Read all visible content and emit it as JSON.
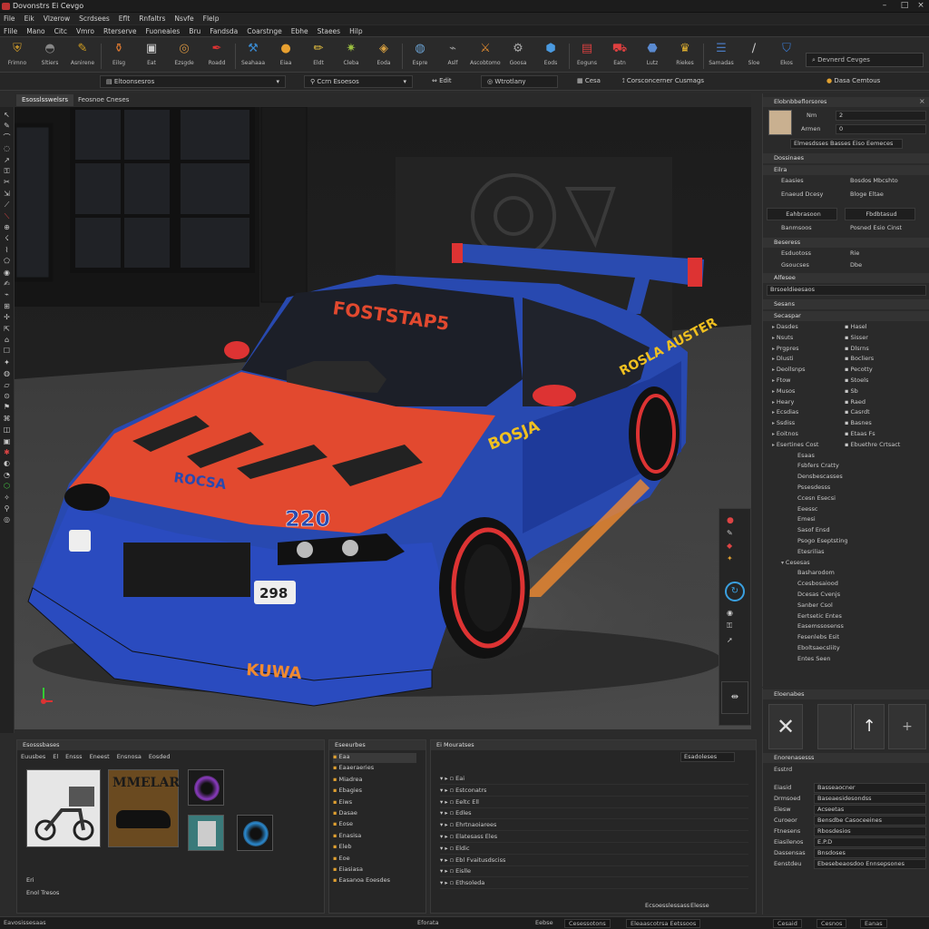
{
  "window": {
    "title": "Dovonstrs Ei Cevgo"
  },
  "menubar1": [
    "File",
    "Eik",
    "Vlzerow",
    "Scrdsees",
    "Eflt",
    "Rnfaltrs",
    "Nsvfe",
    "Flelp"
  ],
  "menubar2": [
    "Flile",
    "Mano",
    "Citc",
    "Vmro",
    "Rterserve",
    "Fuoneaies",
    "Bru",
    "Fandsda",
    "Coarstnge",
    "Ebhe",
    "Staees",
    "Hilp"
  ],
  "toolbar": {
    "buttons": [
      {
        "label": "Frimno",
        "icon": "shield-icon",
        "color": "#c8962a"
      },
      {
        "label": "Sltiers",
        "icon": "helmet-icon",
        "color": "#888"
      },
      {
        "label": "Asnirene",
        "icon": "brush-icon",
        "color": "#d4a020"
      },
      {
        "label": "Eilsg",
        "icon": "pot-icon",
        "color": "#e07a30"
      },
      {
        "label": "Eat",
        "icon": "box-icon",
        "color": "#ccc"
      },
      {
        "label": "Ezsgde",
        "icon": "compass-icon",
        "color": "#d09040"
      },
      {
        "label": "Roadd",
        "icon": "pen-icon",
        "color": "#d33"
      },
      {
        "label": "Seahaaa",
        "icon": "wrench-icon",
        "color": "#3a8ad0"
      },
      {
        "label": "Eiaa",
        "icon": "sphere-icon",
        "color": "#e8a030"
      },
      {
        "label": "Eldt",
        "icon": "pencil-icon",
        "color": "#e6c040"
      },
      {
        "label": "Cleba",
        "icon": "star-icon",
        "color": "#9cc040"
      },
      {
        "label": "Eoda",
        "icon": "box3d-icon",
        "color": "#d8a040"
      },
      {
        "label": "Espre",
        "icon": "globe-icon",
        "color": "#6aa0d0"
      },
      {
        "label": "Aslf",
        "icon": "feather-icon",
        "color": "#999"
      },
      {
        "label": "Ascobtomos",
        "icon": "sword-icon",
        "color": "#e08a30"
      },
      {
        "label": "Goosa",
        "icon": "gear-icon",
        "color": "#aaa"
      },
      {
        "label": "Eods",
        "icon": "cube-icon",
        "color": "#4a9ae0"
      },
      {
        "label": "Eoguns",
        "icon": "printer-icon",
        "color": "#d84040"
      },
      {
        "label": "Eatn",
        "icon": "car-icon",
        "color": "#e04040"
      },
      {
        "label": "Lutz",
        "icon": "badge-icon",
        "color": "#5a8ad0"
      },
      {
        "label": "Riekes",
        "icon": "trophy-icon",
        "color": "#e0b030"
      },
      {
        "label": "Samadas",
        "icon": "layers-icon",
        "color": "#4a7ac0"
      },
      {
        "label": "Sloe",
        "icon": "brush2-icon",
        "color": "#ccc"
      },
      {
        "label": "Ekos",
        "icon": "shield2-icon",
        "color": "#3a7ad0"
      }
    ],
    "search_text": "Devnerd Cevges"
  },
  "subbar": {
    "items": [
      "Satisnesns",
      "Eltoonsesros",
      "Ccrn Esoesos",
      "Edit",
      "Wtrotlany",
      "Cesa",
      "Corsconcerner Cusmags",
      "Dasa Cemtous"
    ]
  },
  "viewport_tabs": [
    "Esosslsswelsrs",
    "Feosnoe Cneses"
  ],
  "viewport": {
    "windshield_text": "FOSTSTAP5",
    "hood_text": "ROCSA",
    "number": "220",
    "plate": "298",
    "side_text": "BOSJA",
    "front_lip_text": "KUWA",
    "side_text2": "ROSLA AUSTER"
  },
  "right_panel": {
    "title": "Elobnbbeflorsores",
    "fields": [
      {
        "label": "Nm",
        "value": "2"
      },
      {
        "label": "Armen",
        "value": "0"
      }
    ],
    "dropdown": "Elmesdsses  Basses Eiso Eemeces",
    "sections": [
      "Dossinaes",
      "Eilra",
      "Beseress",
      "Alfesee",
      "Sesans",
      "Secaspar",
      "Ebaales"
    ],
    "props": [
      [
        "Eaasies",
        "Bosdos Mbcshto"
      ],
      [
        "Enaeud Dcesy",
        "Bloge Eltae"
      ],
      [
        "Eahbrasoon",
        "Fbdbtasud"
      ],
      [
        "Banmsoos",
        "Posned Esio Cinst"
      ],
      [
        "Esduotoss",
        "Rie"
      ],
      [
        "Gsoucses",
        "Dbe"
      ],
      [
        "Brsoeldieesaos",
        ""
      ]
    ],
    "tree": [
      [
        "Dasdes",
        "Hasel"
      ],
      [
        "Nsuts",
        "Sisser"
      ],
      [
        "Prgpres",
        "Dlsrns"
      ],
      [
        "Dlusti",
        "Bocliers"
      ],
      [
        "Deollsnps",
        "Pecotty"
      ],
      [
        "Ftow",
        "Stoels"
      ],
      [
        "Musos",
        "Sb"
      ],
      [
        "Heary",
        "Raed"
      ],
      [
        "Ecsdias",
        "Casrdt"
      ],
      [
        "Ssdiss",
        "Basnes"
      ],
      [
        "Eoitnos",
        "Etaas Fs"
      ],
      [
        "Esertines Cost",
        "Ebuethre Crtsact"
      ]
    ],
    "tree2": [
      "Esaas",
      "Fsbfers Cratty",
      "Densbescasses",
      "Pssesdesss",
      "Ccesn Esecsi",
      "Eeessc",
      "Emesi",
      "Sasof Ensd",
      "Psogo Eseptsting",
      "Etesrilias"
    ],
    "tree3_hdr": "Cesesas",
    "tree3": [
      "Basharodom",
      "Ccesbosaiood",
      "Dcesas Cvenjs",
      "Sanber Csol",
      "Eertsetic Entes",
      "Easemssosenss",
      "Fesenlebs Esit",
      "Eboltsaecsliity",
      "Entes Seen"
    ],
    "bottom": {
      "title": "Eloenabes",
      "hdr": "Enorenasesss",
      "sub": "Esstrd",
      "rows": [
        [
          "Eiasid",
          "Basseaocner"
        ],
        [
          "Drmsoed",
          "Baseaesidesondss"
        ],
        [
          "Elesw",
          "Acseetas"
        ],
        [
          "Curoeor",
          "Bensdbe Casoceeines"
        ],
        [
          "Ftnesens",
          "Rbosdesios"
        ],
        [
          "Eiasilenos",
          "E.P.D"
        ],
        [
          "Dassensas",
          "Bnsdoses"
        ],
        [
          "Eenstdeu",
          "Ebesebeaosdoo Ennsepsones"
        ]
      ]
    }
  },
  "asset_panel": {
    "title": "Esosssbases",
    "toolbar": [
      "Euusbes",
      "El",
      "Ensss",
      "Eneest",
      "Ensnosa",
      "Eosded"
    ],
    "thumb_text": "MMELAR",
    "footer": [
      "Eri",
      "Enol Tresos"
    ]
  },
  "list_panel": {
    "title": "Eseeurbes",
    "items": [
      "Eaa",
      "Eaaeraeries",
      "Miadrea",
      "Ebagies",
      "Eiws",
      "Dasae",
      "Eose",
      "Enasisa",
      "Eleb",
      "Eoe",
      "Eiasiasa",
      "Easanoa Eoesdes"
    ]
  },
  "out_panel": {
    "title": "Ei Mouratses",
    "search": "Esadoleses",
    "rows": [
      "Eai",
      "Estconatrs",
      "Eeltc Ell",
      "Edles",
      "Ehrtnaoiarees",
      "Elatesass Eles",
      "Eldic",
      "Ebl Fvaitusdsciss",
      "Eislle",
      "Ethsoleda"
    ],
    "footer": [
      "Ecsoesslessass",
      "Elesse"
    ]
  },
  "statusbar": [
    "Eavosissesaas",
    "Eforata",
    "Eebse",
    "Cesessotons",
    "Eleaascotrsa Eetssoos",
    "Cesaid",
    "Cesnos",
    "Eanas"
  ]
}
